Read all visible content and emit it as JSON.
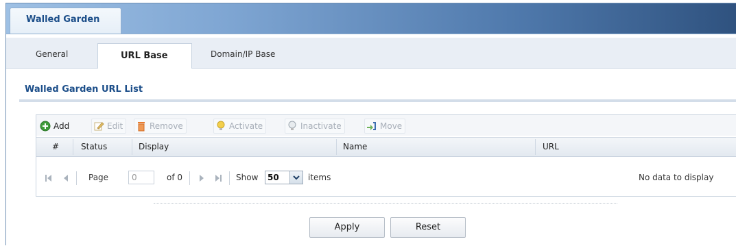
{
  "window": {
    "title_tab": "Walled Garden"
  },
  "tabs": [
    {
      "label": "General",
      "active": false
    },
    {
      "label": "URL Base",
      "active": true
    },
    {
      "label": "Domain/IP Base",
      "active": false
    }
  ],
  "section": {
    "title": "Walled Garden URL List"
  },
  "toolbar": {
    "add": {
      "label": "Add",
      "icon": "add-icon",
      "enabled": true
    },
    "edit": {
      "label": "Edit",
      "icon": "edit-icon",
      "enabled": false
    },
    "remove": {
      "label": "Remove",
      "icon": "trash-icon",
      "enabled": false
    },
    "activate": {
      "label": "Activate",
      "icon": "lightbulb-icon",
      "enabled": false
    },
    "inactivate": {
      "label": "Inactivate",
      "icon": "lightbulb-off-icon",
      "enabled": false
    },
    "move": {
      "label": "Move",
      "icon": "move-icon",
      "enabled": false
    }
  },
  "table": {
    "columns": [
      "#",
      "Status",
      "Display",
      "Name",
      "URL"
    ],
    "rows": []
  },
  "pager": {
    "page_label": "Page",
    "page_value": "0",
    "of_label": "of 0",
    "show_label": "Show",
    "page_size": "50",
    "items_label": "items",
    "empty_text": "No data to display"
  },
  "buttons": {
    "apply": "Apply",
    "reset": "Reset"
  },
  "colors": {
    "title_blue": "#1d4f8a",
    "header_gradient_end": "#2f527f",
    "add_green": "#3f9b3a",
    "remove_orange": "#e77b2e"
  }
}
